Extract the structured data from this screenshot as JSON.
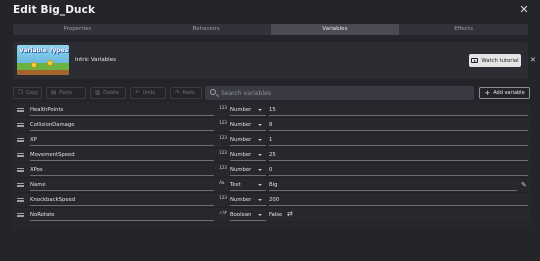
{
  "dialog": {
    "title": "Edit Big_Duck",
    "close_icon": "close-icon"
  },
  "tabs": [
    {
      "label": "Properties",
      "active": false
    },
    {
      "label": "Behaviors",
      "active": false
    },
    {
      "label": "Variables",
      "active": true
    },
    {
      "label": "Effects",
      "active": false
    }
  ],
  "banner": {
    "thumbnail_text": "Variable Types",
    "label": "Intric Variables",
    "watch_label": "Watch tutorial"
  },
  "toolbar": {
    "copy": "Copy",
    "paste": "Paste",
    "delete": "Delete",
    "undo": "Undo",
    "redo": "Redo",
    "search_placeholder": "Search variables",
    "add_label": "Add variable"
  },
  "variables": [
    {
      "name": "HealthPoints",
      "type_icon": "123",
      "type": "Number",
      "value": "15"
    },
    {
      "name": "CollisionDamage",
      "type_icon": "123",
      "type": "Number",
      "value": "8"
    },
    {
      "name": "XP",
      "type_icon": "123",
      "type": "Number",
      "value": "1"
    },
    {
      "name": "MovementSpeed",
      "type_icon": "123",
      "type": "Number",
      "value": "25"
    },
    {
      "name": "XPos",
      "type_icon": "123",
      "type": "Number",
      "value": "0"
    },
    {
      "name": "Name",
      "type_icon": "Aa",
      "type": "Text",
      "value": "Big"
    },
    {
      "name": "KnockbackSpeed",
      "type_icon": "123",
      "type": "Number",
      "value": "200"
    },
    {
      "name": "NoRotate",
      "type_icon": "✓/✗",
      "type": "Boolean",
      "value": "False"
    }
  ],
  "colors": {
    "background": "#24252b",
    "active_tab": "#4a4b53",
    "accent_button": "#e4e4e4"
  }
}
